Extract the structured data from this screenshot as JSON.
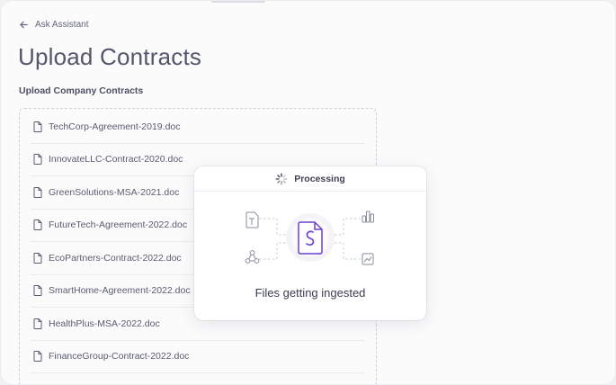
{
  "nav": {
    "back_label": "Ask Assistant",
    "back_icon": "arrow-left-icon"
  },
  "page": {
    "title": "Upload Contracts",
    "section_label": "Upload Company Contracts"
  },
  "files": [
    "TechCorp-Agreement-2019.doc",
    "InnovateLLC-Contract-2020.doc",
    "GreenSolutions-MSA-2021.doc",
    "FutureTech-Agreement-2022.doc",
    "EcoPartners-Contract-2022.doc",
    "SmartHome-Agreement-2022.doc",
    "HealthPlus-MSA-2022.doc",
    "FinanceGroup-Contract-2022.doc"
  ],
  "modal": {
    "status": "Processing",
    "caption": "Files getting ingested",
    "icons": [
      "spinner-icon",
      "text-file-icon",
      "network-icon",
      "document-logo-icon",
      "bar-chart-icon",
      "line-chart-icon"
    ]
  },
  "colors": {
    "accent": "#6b3fd6",
    "background": "#fbfbfc",
    "text": "#54566b"
  }
}
